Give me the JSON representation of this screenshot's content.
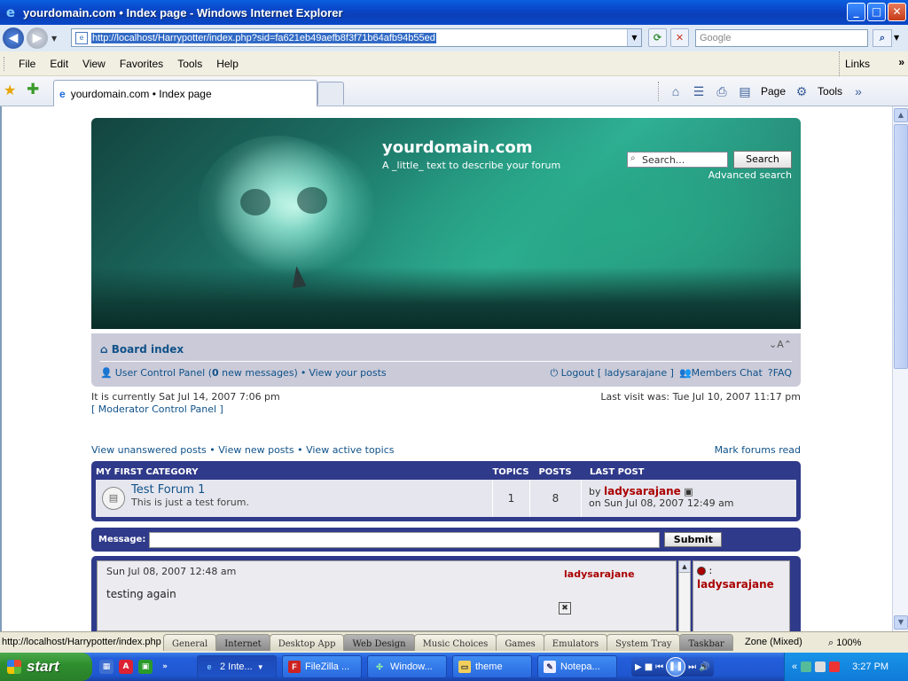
{
  "window": {
    "title": "yourdomain.com • Index page - Windows Internet Explorer",
    "buttons": {
      "minimize": "_",
      "maximize": "□",
      "close": "✕"
    }
  },
  "browser": {
    "url": "http://localhost/Harrypotter/index.php?sid=fa621eb49aefb8f3f71b64afb94b55ed",
    "search_placeholder": "Google",
    "menu": [
      "File",
      "Edit",
      "View",
      "Favorites",
      "Tools",
      "Help"
    ],
    "links_label": "Links",
    "tab_title": "yourdomain.com • Index page",
    "cmd": {
      "page": "Page",
      "tools": "Tools"
    }
  },
  "forum": {
    "site_title": "yourdomain.com",
    "site_desc": "A _little_ text to describe your forum",
    "search_placeholder": "Search...",
    "search_button": "Search",
    "advanced_search": "Advanced search",
    "board_index": "Board index",
    "font_size": "A",
    "ucp_label": "User Control Panel (",
    "ucp_count": "0",
    "ucp_suffix": " new messages)",
    "bullet": "•",
    "view_posts": "View your posts",
    "logout": "Logout [ ladysarajane ]",
    "members_chat": "Members Chat",
    "faq": "FAQ",
    "current_time": "It is currently Sat Jul 14, 2007 7:06 pm",
    "mcp": "[ Moderator Control Panel ]",
    "last_visit": "Last visit was: Tue Jul 10, 2007 11:17 pm",
    "quick_links": [
      "View unanswered posts",
      "View new posts",
      "View active topics"
    ],
    "mark_read": "Mark forums read",
    "category": {
      "name": "MY FIRST CATEGORY",
      "col_topics": "TOPICS",
      "col_posts": "POSTS",
      "col_lastpost": "LAST POST",
      "forums": [
        {
          "title": "Test Forum 1",
          "desc": "This is just a test forum.",
          "topics": "1",
          "posts": "8",
          "by": "by",
          "user": "ladysarajane",
          "date": "on Sun Jul 08, 2007 12:49 am"
        }
      ]
    },
    "chat": {
      "message_label": "Message:",
      "submit": "Submit",
      "messages": [
        {
          "date": "Sun Jul 08, 2007 12:48 am",
          "author": "ladysarajane",
          "text": "testing again"
        }
      ],
      "user_marker": ":",
      "online_user": "ladysarajane"
    }
  },
  "statusbar": {
    "text": "http://localhost/Harrypotter/index.php",
    "zone": "Zone (Mixed)",
    "zoom": "100%",
    "tags": [
      "General",
      "Internet",
      "Desktop App",
      "Web Design",
      "Music Choices",
      "Games",
      "Emulators",
      "System Tray",
      "Taskbar"
    ]
  },
  "taskbar": {
    "start": "start",
    "items": [
      "2 Inte...",
      "FileZilla ...",
      "Window...",
      "theme",
      "Notepa..."
    ],
    "clock": "3:27 PM"
  },
  "colors": {
    "accent": "#2f3a8a",
    "username": "#aa0000",
    "link": "#105289"
  }
}
